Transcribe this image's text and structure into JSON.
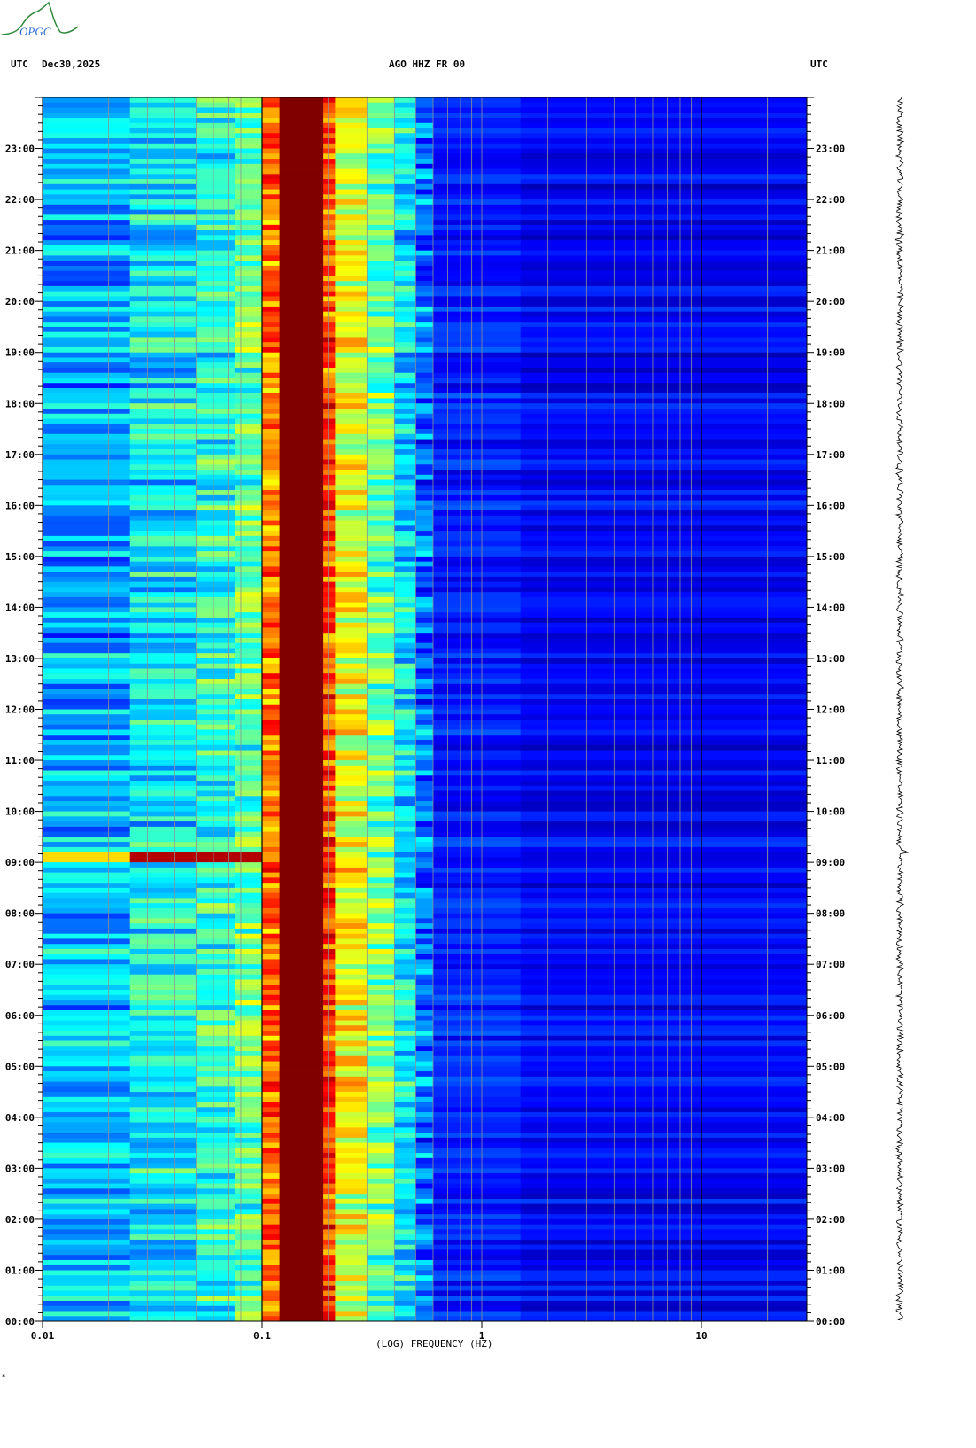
{
  "logo": {
    "text": "OPGC"
  },
  "header": {
    "left_tz": "UTC",
    "date": "Dec30,2025",
    "station": "AGO HHZ FR 00",
    "right_tz": "UTC"
  },
  "footer_mark": "*",
  "chart_data": {
    "type": "heatmap",
    "title": "AGO HHZ FR 00",
    "xlabel": "(LOG) FREQUENCY (HZ)",
    "xscale": "log",
    "xlim": [
      0.01,
      30
    ],
    "x_ticks": [
      "0.01",
      "0.1",
      "1",
      "10"
    ],
    "x_tick_values": [
      0.01,
      0.1,
      1,
      10
    ],
    "ylabel": "UTC",
    "ylim_hours": [
      0,
      24
    ],
    "y_ticks": [
      "00:00",
      "01:00",
      "02:00",
      "03:00",
      "04:00",
      "05:00",
      "06:00",
      "07:00",
      "08:00",
      "09:00",
      "10:00",
      "11:00",
      "12:00",
      "13:00",
      "14:00",
      "15:00",
      "16:00",
      "17:00",
      "18:00",
      "19:00",
      "20:00",
      "21:00",
      "22:00",
      "23:00"
    ],
    "colormap": "jet",
    "band_levels": [
      {
        "f0": 0.01,
        "f1": 0.025,
        "level": 0.3
      },
      {
        "f0": 0.025,
        "f1": 0.05,
        "level": 0.37
      },
      {
        "f0": 0.05,
        "f1": 0.075,
        "level": 0.41
      },
      {
        "f0": 0.075,
        "f1": 0.1,
        "level": 0.47
      },
      {
        "f0": 0.1,
        "f1": 0.12,
        "level": 0.76
      },
      {
        "f0": 0.12,
        "f1": 0.19,
        "level": 1.0
      },
      {
        "f0": 0.19,
        "f1": 0.215,
        "level": 0.8
      },
      {
        "f0": 0.215,
        "f1": 0.3,
        "level": 0.6
      },
      {
        "f0": 0.3,
        "f1": 0.4,
        "level": 0.48
      },
      {
        "f0": 0.4,
        "f1": 0.5,
        "level": 0.36
      },
      {
        "f0": 0.5,
        "f1": 0.6,
        "level": 0.24
      },
      {
        "f0": 0.6,
        "f1": 1.5,
        "level": 0.15
      },
      {
        "f0": 1.5,
        "f1": 30,
        "level": 0.12
      }
    ],
    "events": [
      {
        "time_hours": 9.1,
        "duration_hours": 0.3,
        "f_max": 0.1,
        "level": 0.95
      }
    ],
    "trace_spikes_hours": [
      21.2,
      9.2
    ],
    "colors": {
      "background": "#ffffff",
      "grid_minor": "#909090",
      "grid_major": "#000000",
      "trace": "#000000"
    }
  }
}
